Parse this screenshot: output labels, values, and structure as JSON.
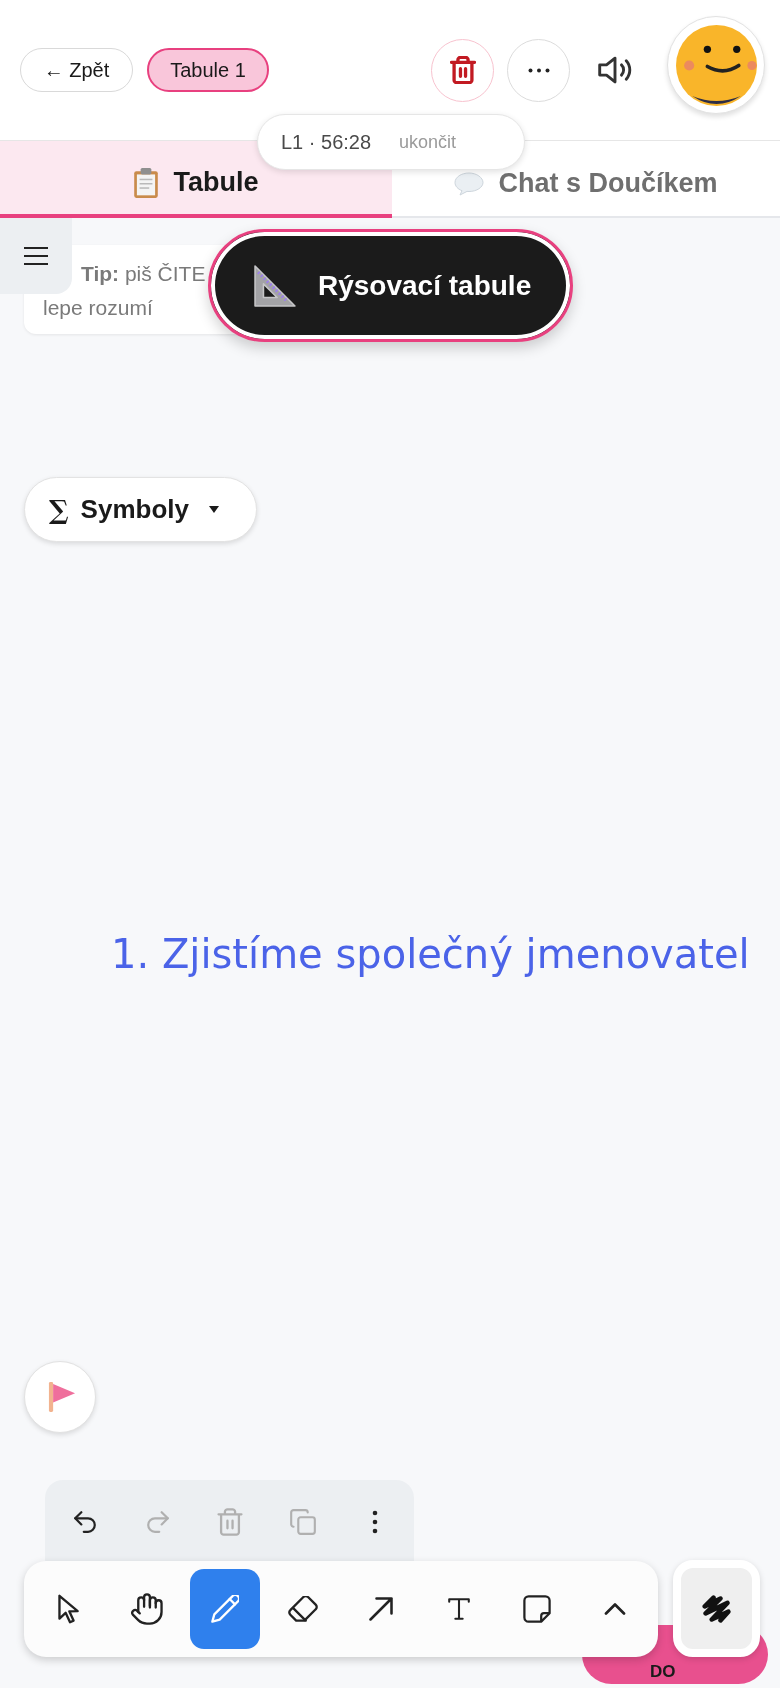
{
  "header": {
    "back_button": "← Zpět",
    "board_chip": "Tabule 1"
  },
  "session": {
    "timer": "L1 · 56:28",
    "end_link": "ukončit"
  },
  "tabs": [
    {
      "label": "Tabule",
      "selected": true
    },
    {
      "label": "Chat s Doučíkem",
      "selected": false
    }
  ],
  "tip": {
    "lines": [
      "**Tip:** piš ČITE",
      "lepe rozumí"
    ]
  },
  "ruler_board_button": "Rýsovací tabule",
  "symbols_button": {
    "glyph": "∑",
    "label": "Symboly"
  },
  "canvas_texts": [
    "1. Zjistíme společný jmenovatel"
  ],
  "history_toolbar": [
    {
      "kind": "undo",
      "disabled": false
    },
    {
      "kind": "redo",
      "disabled": true
    },
    {
      "kind": "delete",
      "disabled": true
    },
    {
      "kind": "duplicate",
      "disabled": true
    },
    {
      "kind": "more",
      "disabled": false
    }
  ],
  "tools": [
    {
      "kind": "select",
      "selected": false
    },
    {
      "kind": "hand",
      "selected": false
    },
    {
      "kind": "pencil",
      "selected": true
    },
    {
      "kind": "eraser",
      "selected": false
    },
    {
      "kind": "arrow",
      "selected": false
    },
    {
      "kind": "text",
      "selected": false
    },
    {
      "kind": "note",
      "selected": false
    },
    {
      "kind": "expand",
      "selected": false
    }
  ],
  "action_button": "DO"
}
